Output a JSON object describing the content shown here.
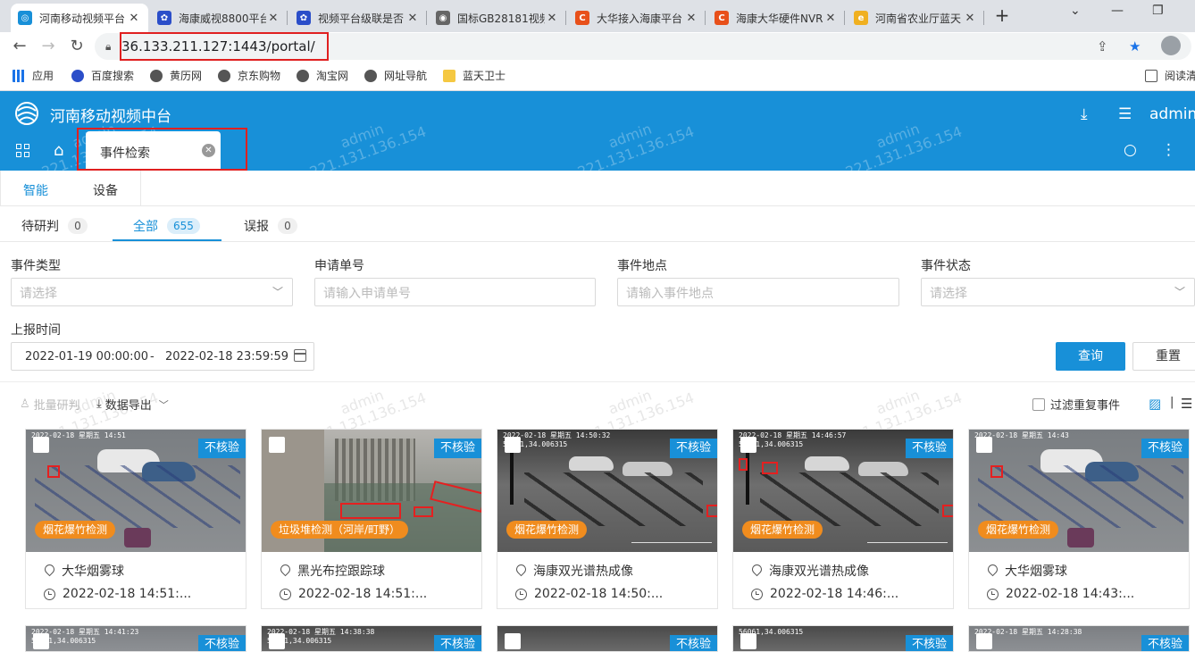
{
  "browser": {
    "tabs": [
      {
        "title": "河南移动视频平台",
        "favicon_color": "#1890d8",
        "glyph": "◎"
      },
      {
        "title": "海康威视8800平台",
        "favicon_color": "#2b4ec9",
        "glyph": "✿"
      },
      {
        "title": "视频平台级联是否",
        "favicon_color": "#2b4ec9",
        "glyph": "✿"
      },
      {
        "title": "国标GB28181视频",
        "favicon_color": "#666666",
        "glyph": "◉"
      },
      {
        "title": "大华接入海康平台",
        "favicon_color": "#e8501a",
        "glyph": "C"
      },
      {
        "title": "海康大华硬件NVR",
        "favicon_color": "#e8501a",
        "glyph": "C"
      },
      {
        "title": "河南省农业厅蓝天",
        "favicon_color": "#f0b020",
        "glyph": "e"
      }
    ],
    "new_tab": "+",
    "url": "36.133.211.127:1443/portal/",
    "bookmarks": [
      {
        "label": "应用",
        "icon_color": "#1a73e8"
      },
      {
        "label": "百度搜索",
        "icon_color": "#2b4ec9"
      },
      {
        "label": "黄历网",
        "icon_color": "#555555"
      },
      {
        "label": "京东购物",
        "icon_color": "#555555"
      },
      {
        "label": "淘宝网",
        "icon_color": "#555555"
      },
      {
        "label": "网址导航",
        "icon_color": "#555555"
      },
      {
        "label": "蓝天卫士",
        "icon_color": "#f5c842"
      }
    ],
    "reading_list": "阅读清"
  },
  "app": {
    "title": "河南移动视频中台",
    "user": "admin",
    "open_tab": "事件检索",
    "watermark": "admin\n221.131.136.154",
    "accent": "#1890d8"
  },
  "subnav": [
    "智能",
    "设备"
  ],
  "status_tabs": [
    {
      "label": "待研判",
      "count": "0"
    },
    {
      "label": "全部",
      "count": "655"
    },
    {
      "label": "误报",
      "count": "0"
    }
  ],
  "filters": {
    "event_type": {
      "label": "事件类型",
      "placeholder": "请选择"
    },
    "request_no": {
      "label": "申请单号",
      "placeholder": "请输入申请单号"
    },
    "location": {
      "label": "事件地点",
      "placeholder": "请输入事件地点"
    },
    "status": {
      "label": "事件状态",
      "placeholder": "请选择"
    },
    "report_time": {
      "label": "上报时间",
      "start": "2022-01-19 00:00:00",
      "sep": "-",
      "end": "2022-02-18 23:59:59"
    },
    "query_button": "查询",
    "reset_button": "重置"
  },
  "toolbar": {
    "batch": "批量研判",
    "export": "数据导出",
    "dedupe": "过滤重复事件"
  },
  "cards": [
    {
      "badge": "不核验",
      "tag": "烟花爆竹检测",
      "location": "大华烟雾球",
      "time": "2022-02-18 14:51:...",
      "scene": "day",
      "osd": "2022-02-18 星期五 14:51"
    },
    {
      "badge": "不核验",
      "tag": "垃圾堆检测（河岸/町野）",
      "location": "黑光布控跟踪球",
      "time": "2022-02-18 14:51:...",
      "scene": "site",
      "osd": ""
    },
    {
      "badge": "不核验",
      "tag": "烟花爆竹检测",
      "location": "海康双光谱热成像",
      "time": "2022-02-18 14:50:...",
      "scene": "ir",
      "osd": "2022-02-18 星期五 14:50:32\n56061,34.006315"
    },
    {
      "badge": "不核验",
      "tag": "烟花爆竹检测",
      "location": "海康双光谱热成像",
      "time": "2022-02-18 14:46:...",
      "scene": "ir",
      "osd": "2022-02-18 星期五 14:46:57\n56061,34.006315"
    },
    {
      "badge": "不核验",
      "tag": "烟花爆竹检测",
      "location": "大华烟雾球",
      "time": "2022-02-18 14:43:...",
      "scene": "day",
      "osd": "2022-02-18 星期五 14:43"
    }
  ],
  "cards_row2": [
    {
      "badge": "不核验",
      "osd": "2022-02-18 星期五 14:41:23\n56061,34.006315"
    },
    {
      "badge": "不核验",
      "osd": "2022-02-18 星期五 14:38:38\n56061,34.006315"
    },
    {
      "badge": "不核验",
      "osd": ""
    },
    {
      "badge": "不核验",
      "osd": "56061,34.006315"
    },
    {
      "badge": "不核验",
      "osd": "2022-02-18 星期五 14:28:38"
    }
  ]
}
